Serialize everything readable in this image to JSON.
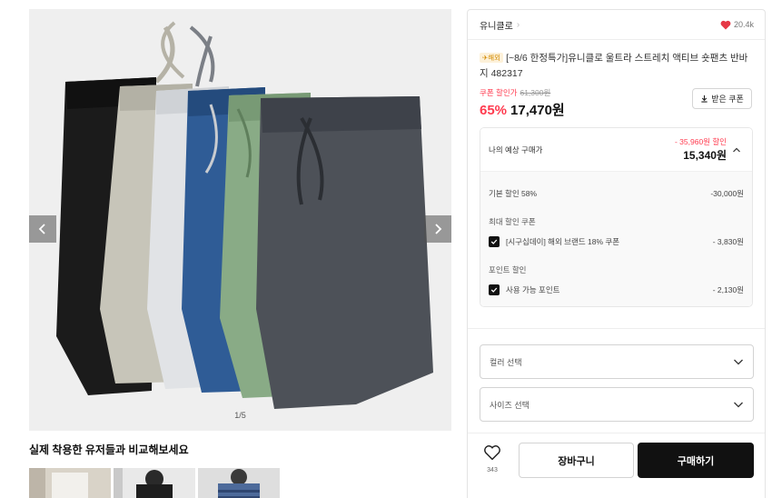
{
  "gallery": {
    "counter": "1/5",
    "colors": [
      "#1b1b1b",
      "#c7c5b9",
      "#e1e3e6",
      "#2f5c96",
      "#89ab86",
      "#4d5158"
    ]
  },
  "compare": {
    "title": "실제 착용한 유저들과 비교해보세요"
  },
  "brand": {
    "name": "유니클로",
    "chevron": "›",
    "likes": "20.4k"
  },
  "product": {
    "badge": "✈해외",
    "title": "[~8/6 한정특가]유니클로 울트라 스트레치 액티브 숏팬츠 반바지 482317"
  },
  "price": {
    "coupon_label": "쿠폰 할인가",
    "original": "61,300원",
    "discount_pct": "65%",
    "sale": "17,470원",
    "coupon_button": "받은 쿠폰"
  },
  "estimate": {
    "label": "나의 예상 구매가",
    "savings": "- 35,960원 할인",
    "total": "15,340원",
    "base_label": "기본 할인 58%",
    "base_value": "-30,000원",
    "coupon_section": "최대 할인 쿠폰",
    "coupon_item": "[시구십데이] 해외 브랜드 18% 쿠폰",
    "coupon_value": "- 3,830원",
    "point_section": "포인트 할인",
    "point_item": "사용 가능 포인트",
    "point_value": "- 2,130원"
  },
  "options": {
    "color_placeholder": "컬러 선택",
    "size_placeholder": "사이즈 선택"
  },
  "actions": {
    "wish_count": "343",
    "cart_label": "장바구니",
    "buy_label": "구매하기"
  }
}
